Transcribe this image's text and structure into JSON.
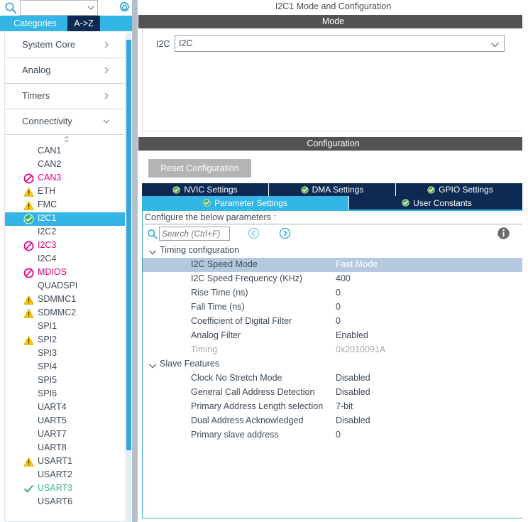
{
  "sidebar": {
    "search": {
      "value": "",
      "placeholder": "",
      "icon": "search-icon",
      "caret_icon": "chevron-down-icon"
    },
    "gear_icon": "gear-icon",
    "tabs": [
      {
        "label": "Categories",
        "active": true
      },
      {
        "label": "A->Z",
        "active": false
      }
    ],
    "categories": [
      {
        "label": "System Core",
        "expanded": false,
        "chevron": "chevron-right-icon"
      },
      {
        "label": "Analog",
        "expanded": false,
        "chevron": "chevron-right-icon"
      },
      {
        "label": "Timers",
        "expanded": false,
        "chevron": "chevron-right-icon"
      },
      {
        "label": "Connectivity",
        "expanded": true,
        "chevron": "chevron-down-icon"
      }
    ],
    "peripherals": [
      {
        "label": "CAN1",
        "status": "none",
        "icon": ""
      },
      {
        "label": "CAN2",
        "status": "none",
        "icon": ""
      },
      {
        "label": "CAN3",
        "status": "blocked",
        "icon": "forbidden-icon"
      },
      {
        "label": "ETH",
        "status": "warning",
        "icon": "warning-triangle-icon"
      },
      {
        "label": "FMC",
        "status": "warning",
        "icon": "warning-triangle-icon"
      },
      {
        "label": "I2C1",
        "status": "configured-selected",
        "icon": "check-circle-icon"
      },
      {
        "label": "I2C2",
        "status": "none",
        "icon": ""
      },
      {
        "label": "I2C3",
        "status": "blocked",
        "icon": "forbidden-icon"
      },
      {
        "label": "I2C4",
        "status": "none",
        "icon": ""
      },
      {
        "label": "MDIOS",
        "status": "blocked",
        "icon": "forbidden-icon"
      },
      {
        "label": "QUADSPI",
        "status": "none",
        "icon": ""
      },
      {
        "label": "SDMMC1",
        "status": "warning",
        "icon": "warning-triangle-icon"
      },
      {
        "label": "SDMMC2",
        "status": "warning",
        "icon": "warning-triangle-icon"
      },
      {
        "label": "SPI1",
        "status": "none",
        "icon": ""
      },
      {
        "label": "SPI2",
        "status": "warning",
        "icon": "warning-triangle-icon"
      },
      {
        "label": "SPI3",
        "status": "none",
        "icon": ""
      },
      {
        "label": "SPI4",
        "status": "none",
        "icon": ""
      },
      {
        "label": "SPI5",
        "status": "none",
        "icon": ""
      },
      {
        "label": "SPI6",
        "status": "none",
        "icon": ""
      },
      {
        "label": "UART4",
        "status": "none",
        "icon": ""
      },
      {
        "label": "UART5",
        "status": "none",
        "icon": ""
      },
      {
        "label": "UART7",
        "status": "none",
        "icon": ""
      },
      {
        "label": "UART8",
        "status": "none",
        "icon": ""
      },
      {
        "label": "USART1",
        "status": "warning",
        "icon": "warning-triangle-icon"
      },
      {
        "label": "USART2",
        "status": "none",
        "icon": ""
      },
      {
        "label": "USART3",
        "status": "configured",
        "icon": "check-icon"
      },
      {
        "label": "USART6",
        "status": "none",
        "icon": ""
      }
    ]
  },
  "main": {
    "title": "I2C1 Mode and Configuration",
    "mode": {
      "band": "Mode",
      "field_label": "I2C",
      "selected": "I2C",
      "chevron": "chevron-down-icon"
    },
    "configuration": {
      "band": "Configuration",
      "reset_button": "Reset Configuration",
      "tabs_row1": [
        {
          "label": "NVIC Settings",
          "active": false,
          "icon": "check-circle-icon"
        },
        {
          "label": "DMA Settings",
          "active": false,
          "icon": "check-circle-icon"
        },
        {
          "label": "GPIO Settings",
          "active": false,
          "icon": "check-circle-icon"
        }
      ],
      "tabs_row2": [
        {
          "label": "Parameter Settings",
          "active": true,
          "icon": "check-circle-icon"
        },
        {
          "label": "User Constants",
          "active": false,
          "icon": "check-circle-icon"
        }
      ],
      "hint": "Configure the below parameters :",
      "search": {
        "value": "",
        "placeholder": "Search (Ctrl+F)",
        "icon": "search-icon"
      },
      "prev_icon": "arrow-left-circle-icon",
      "next_icon": "arrow-right-circle-icon",
      "info_icon": "info-icon",
      "groups": [
        {
          "label": "Timing configuration",
          "expanded": true,
          "chevron": "chevron-down-icon",
          "rows": [
            {
              "name": "I2C Speed Mode",
              "value": "Fast Mode",
              "selected": true,
              "disabled": false
            },
            {
              "name": "I2C Speed Frequency (KHz)",
              "value": "400",
              "selected": false,
              "disabled": false
            },
            {
              "name": "Rise Time (ns)",
              "value": "0",
              "selected": false,
              "disabled": false
            },
            {
              "name": "Fall Time (ns)",
              "value": "0",
              "selected": false,
              "disabled": false
            },
            {
              "name": "Coefficient of Digital Filter",
              "value": "0",
              "selected": false,
              "disabled": false
            },
            {
              "name": "Analog Filter",
              "value": "Enabled",
              "selected": false,
              "disabled": false
            },
            {
              "name": "Timing",
              "value": "0x2010091A",
              "selected": false,
              "disabled": true
            }
          ]
        },
        {
          "label": "Slave Features",
          "expanded": true,
          "chevron": "chevron-down-icon",
          "rows": [
            {
              "name": "Clock No Stretch Mode",
              "value": "Disabled",
              "selected": false,
              "disabled": false
            },
            {
              "name": "General Call Address Detection",
              "value": "Disabled",
              "selected": false,
              "disabled": false
            },
            {
              "name": "Primary Address Length selection",
              "value": "7-bit",
              "selected": false,
              "disabled": false
            },
            {
              "name": "Dual Address Acknowledged",
              "value": "Disabled",
              "selected": false,
              "disabled": false
            },
            {
              "name": "Primary slave address",
              "value": "0",
              "selected": false,
              "disabled": false
            }
          ]
        }
      ]
    }
  },
  "colors": {
    "accent_cyan": "#33b5e5",
    "tab_navy": "#0d2b52",
    "band_grey": "#535353",
    "warning_yellow": "#ffcc00",
    "error_magenta": "#e3007e",
    "ok_green": "#3fb680",
    "row_selected": "#b4c8de"
  }
}
